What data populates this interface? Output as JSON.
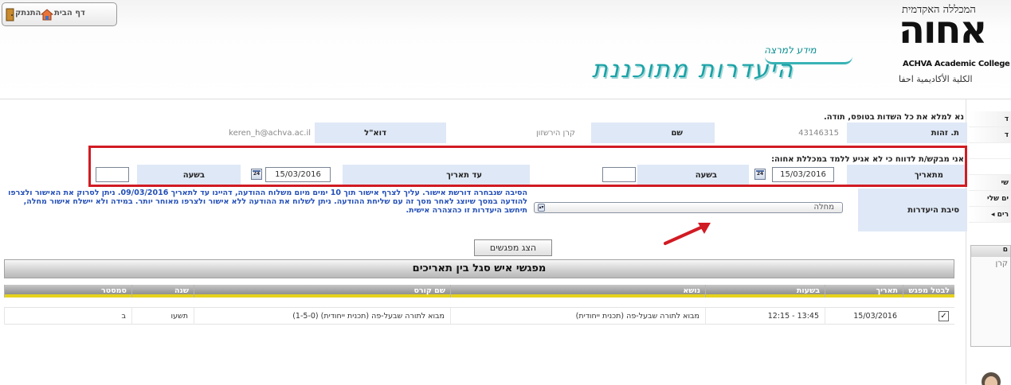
{
  "toplinks": {
    "home": "דף הבית",
    "logout": "התנתק"
  },
  "logo": {
    "line1": "המכללה האקדמית",
    "big": "אחוה",
    "english": "ACHVA Academic College",
    "arabic": "الكلية الأكاديمية احفا"
  },
  "page": {
    "subtitle": "מידע למרצה",
    "title": "היעדרות מתוכננת"
  },
  "instructions": "נא למלא את כל השדות בטופס, תודה.",
  "identity": {
    "id_label": "ת. זהות",
    "id_value": "43146315",
    "name_label": "שם",
    "name_value": "קרן הירשזון",
    "email_label": "דוא\"ל",
    "email_value": "keren_h@achva.ac.il"
  },
  "request_text": "אני מבקש/ת לדווח כי לא אגיע ללמד במכללת אחוה:",
  "range": {
    "from_label": "מתאריך",
    "from_date": "15/03/2016",
    "from_time_label": "בשעה",
    "from_time": "",
    "to_label": "עד תאריך",
    "to_date": "15/03/2016",
    "to_time_label": "בשעה",
    "to_time": "",
    "cal_icon_text": "24"
  },
  "reason": {
    "label": "סיבת היעדרות",
    "selected": "מחלה"
  },
  "notice": "הסיבה שנבחרה דורשת אישור. עליך לצרף אישור תוך 10 ימים מיום משלוח ההודעה, דהיינו עד לתאריך 09/03/2016. ניתן לסרוק את האישור ולצרפו להודעה במסך שיוצג לאחר מסך זה עם שליחת ההודעה. ניתן לשלוח את ההודעה ללא אישור ולצרפו מאוחר יותר. במידה ולא יישלח אישור מחלה, תיחשב היעדרות זו כהצהרה אישית.",
  "show_button": "הצג מפגשים",
  "grid": {
    "title": "מפגשי איש סגל בין תאריכים",
    "columns": [
      "לבטל מפגש",
      "תאריך",
      "בשעות",
      "נושא",
      "שם קורס",
      "שנה",
      "סמסטר"
    ],
    "rows": [
      {
        "cancel": "✓",
        "date": "15/03/2016",
        "hours": "13:45 - 12:15",
        "topic": "מבוא לתורה שבעל-פה (תכנית ייחודית)",
        "course": "מבוא לתורה שבעל-פה (תכנית ייחודית) (1-5-0)",
        "year": "תשעו",
        "semester": "ב"
      }
    ]
  },
  "sidebar": {
    "items": [
      "ים שלי",
      "רים ◂",
      "ד",
      "ד",
      "שי"
    ],
    "box_text": "קרן",
    "box_title": "ם"
  },
  "colors": {
    "accent": "#1aa3a7",
    "highlight": "#d11b23",
    "notice": "#2450b8",
    "label_bg": "#dfe8f6"
  }
}
